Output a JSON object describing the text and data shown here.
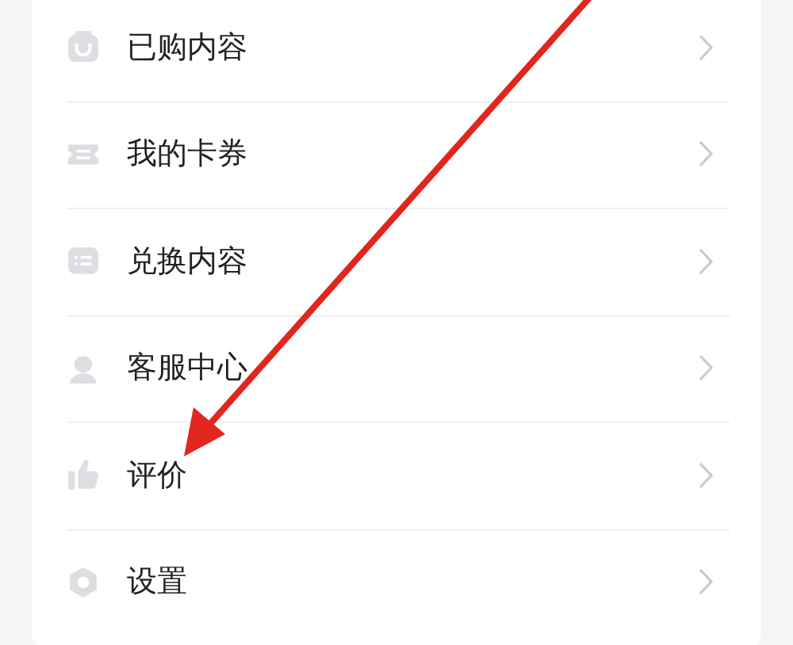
{
  "menu": [
    {
      "kind": "bag",
      "label": "已购内容"
    },
    {
      "kind": "ticket",
      "label": "我的卡券"
    },
    {
      "kind": "list",
      "label": "兑换内容"
    },
    {
      "kind": "agent",
      "label": "客服中心"
    },
    {
      "kind": "thumb",
      "label": "评价"
    },
    {
      "kind": "gear",
      "label": "设置"
    }
  ]
}
